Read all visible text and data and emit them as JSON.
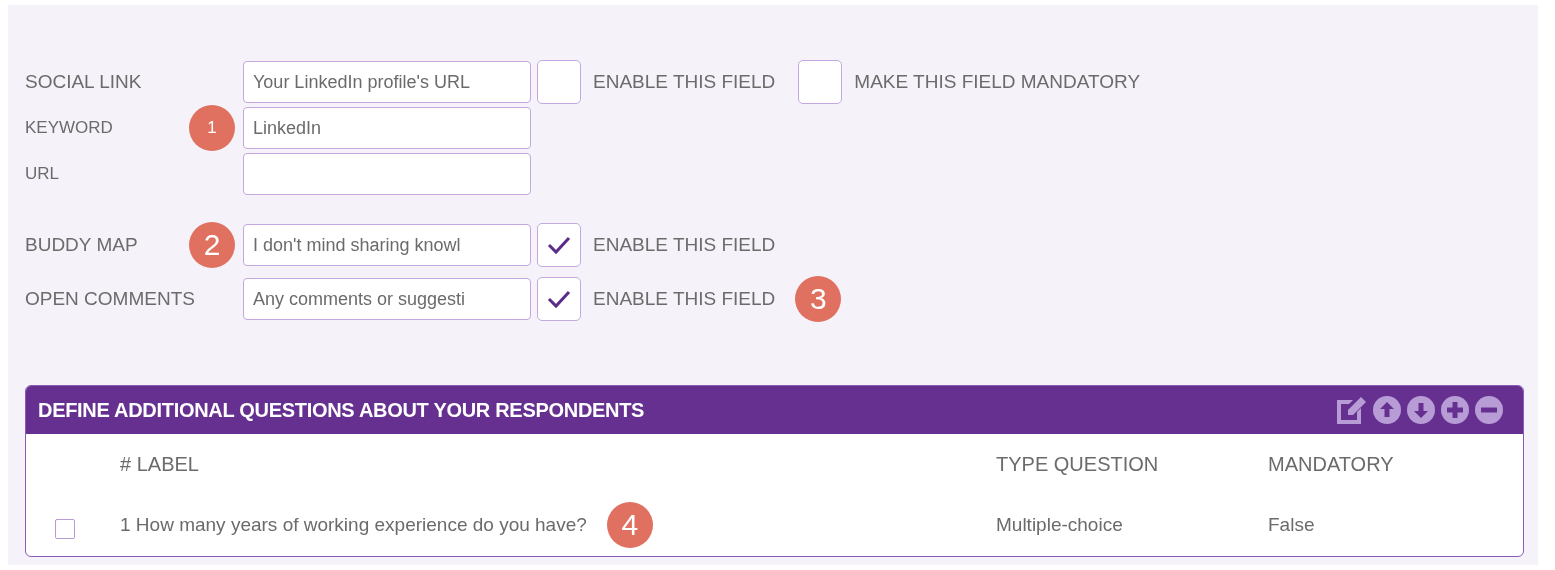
{
  "form_rows": [
    {
      "kind": "main",
      "label": "SOCIAL LINK",
      "value": "Your LinkedIn profile's URL",
      "enable": {
        "label": "ENABLE THIS FIELD",
        "checked": false
      },
      "mandatory": {
        "label": "MAKE THIS FIELD MANDATORY",
        "checked": false
      }
    },
    {
      "kind": "sub",
      "label": "KEYWORD",
      "value": "LinkedIn",
      "callout": {
        "text": "1",
        "kind": "label"
      }
    },
    {
      "kind": "sub",
      "label": "URL"
    },
    {
      "kind": "main",
      "label": "BUDDY MAP",
      "value": "I don't mind sharing knowl",
      "enable": {
        "label": "ENABLE THIS FIELD",
        "checked": true
      },
      "callout": {
        "text": "2",
        "kind": "label"
      }
    },
    {
      "kind": "main",
      "label": "OPEN COMMENTS",
      "value": "Any comments or suggesti",
      "enable": {
        "label": "ENABLE THIS FIELD",
        "checked": true
      },
      "callout": {
        "text": "3",
        "kind": "end"
      }
    }
  ],
  "questions_panel": {
    "title": "DEFINE ADDITIONAL QUESTIONS ABOUT YOUR RESPONDENTS",
    "columns": [
      "# LABEL",
      "TYPE QUESTION",
      "MANDATORY"
    ],
    "rows": [
      {
        "checked": false,
        "number": "1",
        "label": "How many years of working experience do you have?",
        "type": "Multiple-choice",
        "mandatory": "False",
        "callout": {
          "text": "4",
          "kind": "end"
        }
      }
    ]
  }
}
